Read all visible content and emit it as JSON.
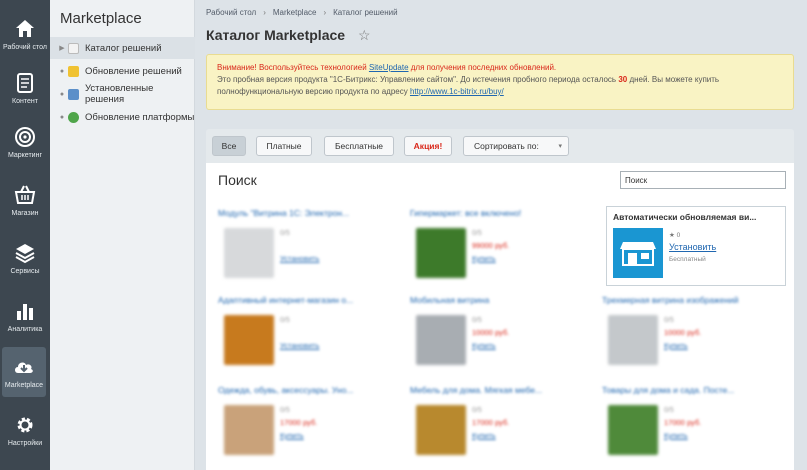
{
  "rail": [
    {
      "label": "Рабочий стол",
      "icon": "home-icon"
    },
    {
      "label": "Контент",
      "icon": "document-icon"
    },
    {
      "label": "Маркетинг",
      "icon": "target-icon"
    },
    {
      "label": "Магазин",
      "icon": "basket-icon"
    },
    {
      "label": "Сервисы",
      "icon": "layers-icon"
    },
    {
      "label": "Аналитика",
      "icon": "bar-chart-icon"
    },
    {
      "label": "Marketplace",
      "icon": "cloud-download-icon"
    },
    {
      "label": "Настройки",
      "icon": "gear-icon"
    }
  ],
  "panel": {
    "title": "Marketplace",
    "items": [
      {
        "label": "Каталог решений"
      },
      {
        "label": "Обновление решений"
      },
      {
        "label": "Установленные решения"
      },
      {
        "label": "Обновление платформы"
      }
    ]
  },
  "breadcrumb": [
    "Рабочий стол",
    "Marketplace",
    "Каталог решений"
  ],
  "breadcrumb_sep": "›",
  "page": {
    "title": "Каталог Marketplace",
    "star": "☆"
  },
  "notice": {
    "line1_red": "Внимание! Воспользуйтесь технологией",
    "line1_link": "SiteUpdate",
    "line1_red_end": "для получения последних обновлений.",
    "line2_a": "Это пробная версия продукта \"1С-Битрикс: Управление сайтом\". До истечения пробного периода осталось",
    "line2_days": "30",
    "line2_b": "дней. Вы можете купить",
    "line3_a": "полнофункциональную версию продукта по адресу",
    "line3_link": "http://www.1c-bitrix.ru/buy/"
  },
  "filters": {
    "all": "Все",
    "paid": "Платные",
    "free": "Бесплатные",
    "promo": "Акция!",
    "sort": "Сортировать по:"
  },
  "search": {
    "title": "Поиск",
    "value": "Поиск"
  },
  "cards": [
    {
      "title": "Модуль \"Витрина 1С: Электрон...",
      "m1": "0/5",
      "m2": "",
      "m3": "Установить",
      "thumb": "#d7d9db"
    },
    {
      "title": "Гипермаркет: все включено!",
      "m1": "0/5",
      "m2": "99000 руб.",
      "m3": "Купить",
      "thumb": "#3d7a2a"
    },
    {
      "title": "Адаптивный интернет-магазин о...",
      "m1": "0/5",
      "m2": "",
      "m3": "Установить",
      "thumb": "#c77a1e"
    },
    {
      "title": "Мобильная витрина",
      "m1": "0/5",
      "m2": "10000 руб.",
      "m3": "Купить",
      "thumb": "#a8adb2"
    },
    {
      "title": "Трехмерная витрина изображений",
      "m1": "0/5",
      "m2": "10000 руб.",
      "m3": "Купить",
      "thumb": "#c4c8cb"
    },
    {
      "title": "Одежда, обувь, аксессуары. Уно...",
      "m1": "0/5",
      "m2": "17000 руб.",
      "m3": "Купить",
      "thumb": "#c9a27a"
    },
    {
      "title": "Мебель для дома. Мягкая мебе...",
      "m1": "0/5",
      "m2": "17000 руб.",
      "m3": "Купить",
      "thumb": "#b8892e"
    },
    {
      "title": "Товары для дома и сада. Посте...",
      "m1": "0/5",
      "m2": "17000 руб.",
      "m3": "Купить",
      "thumb": "#4f8a3a"
    }
  ],
  "featured": {
    "title": "Автоматически обновляемая ви...",
    "rating": "★ 0",
    "link": "Установить",
    "price": "Бесплатный"
  },
  "colors": {
    "rail": "#3d4750",
    "accent_link": "#2067b0",
    "alert_red": "#d9271a",
    "notice_bg": "#f9f3c4"
  }
}
